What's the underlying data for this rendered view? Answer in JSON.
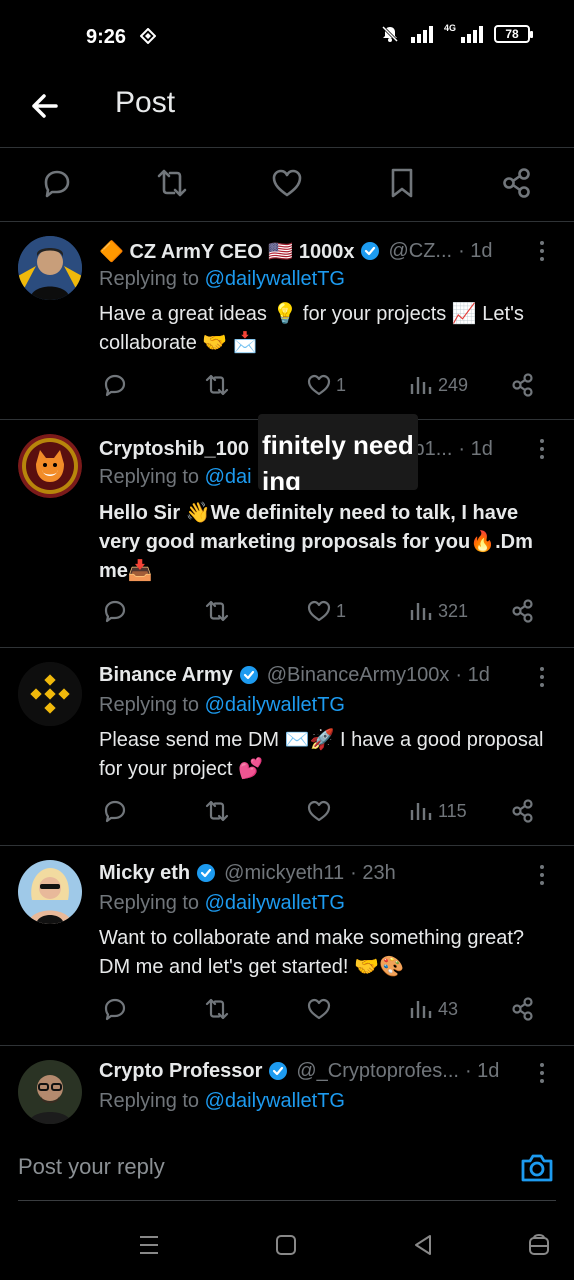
{
  "status": {
    "time": "9:26",
    "battery": "78",
    "net_label": "4G"
  },
  "header": {
    "title": "Post"
  },
  "actionbar": {
    "icons": [
      "reply-icon",
      "retweet-icon",
      "like-icon",
      "bookmark-icon",
      "share-icon"
    ]
  },
  "replies": [
    {
      "name": "🔶 CZ ArmY CEO 🇺🇸 1000x",
      "verified": true,
      "handle": "@CZ...",
      "time": "· 1d",
      "replying_prefix": "Replying to ",
      "replying_to": "@dailywalletTG",
      "text": "Have a great ideas 💡 for your projects 📈 Let's collaborate 🤝 📩",
      "likes": "1",
      "views": "249"
    },
    {
      "name": "Cryptoshib_100",
      "verified": false,
      "handle": "ib1...",
      "time": "· 1d",
      "replying_prefix": "Replying to ",
      "replying_to": "@dai",
      "text": "Hello Sir 👋We definitely need to talk, I have very good marketing proposals for you🔥.Dm me📥",
      "likes": "1",
      "views": "321",
      "overlay_line1": "finitely need",
      "overlay_line2": "ing proposals"
    },
    {
      "name": "Binance Army",
      "verified": true,
      "handle": "@BinanceArmy100x",
      "time": "· 1d",
      "replying_prefix": "Replying to ",
      "replying_to": "@dailywalletTG",
      "text": "Please send me DM ✉️🚀 I have a good proposal for your project 💕",
      "likes": "",
      "views": "115"
    },
    {
      "name": "Micky eth",
      "verified": true,
      "handle": "@mickyeth11",
      "time": "· 23h",
      "replying_prefix": "Replying to ",
      "replying_to": "@dailywalletTG",
      "text": "Want to collaborate and make something great? DM me and let's get started! 🤝🎨",
      "likes": "",
      "views": "43"
    },
    {
      "name": "Crypto Professor",
      "verified": true,
      "handle": "@_Cryptoprofes...",
      "time": "· 1d",
      "replying_prefix": "Replying to ",
      "replying_to": "@dailywalletTG"
    }
  ],
  "composer": {
    "placeholder": "Post your reply"
  },
  "colors": {
    "accent": "#1d9bf0",
    "muted": "#71767b",
    "bg": "#000000",
    "divider": "#2f3336"
  }
}
